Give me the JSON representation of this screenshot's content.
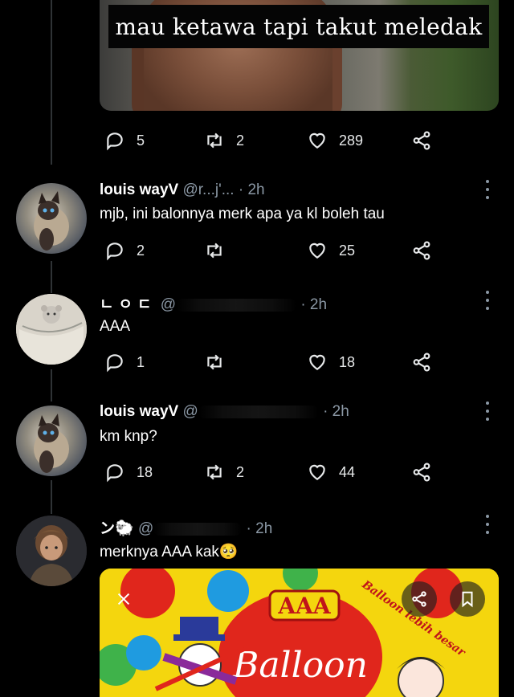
{
  "top_post": {
    "caption": "mau ketawa tapi takut meledak",
    "reply_count": "5",
    "retweet_count": "2",
    "like_count": "289"
  },
  "replies": [
    {
      "name": "louis wayV",
      "handle": "@r...j'...",
      "time": "· 2h",
      "text": "mjb, ini balonnya merk apa ya kl boleh tau",
      "reply_count": "2",
      "retweet_count": "",
      "like_count": "25"
    },
    {
      "name": "ㄴㅇㄷ",
      "handle": "@",
      "time": "· 2h",
      "text": "AAA",
      "reply_count": "1",
      "retweet_count": "",
      "like_count": "18"
    },
    {
      "name": "louis wayV",
      "handle": "@",
      "time": "· 2h",
      "text": "km knp?",
      "reply_count": "18",
      "retweet_count": "2",
      "like_count": "44"
    },
    {
      "name": "ン🐑",
      "handle": "@",
      "time": "· 2h",
      "text": "merknya AAA kak🥺"
    }
  ],
  "balloon_image": {
    "brand_badge": "AAA",
    "brand_word": "Balloon",
    "arc_text": "Balloon lebih besar"
  },
  "icons": {
    "reply": "reply-icon",
    "retweet": "retweet-icon",
    "like": "heart-icon",
    "share": "share-icon",
    "more": "more-vertical-icon",
    "close": "close-icon",
    "bookmark": "bookmark-icon"
  },
  "colors": {
    "background": "#000000",
    "text": "#e7e9ea",
    "muted": "#8b98a5",
    "balloon_yellow": "#f4d60e",
    "balloon_red": "#e0261c"
  }
}
